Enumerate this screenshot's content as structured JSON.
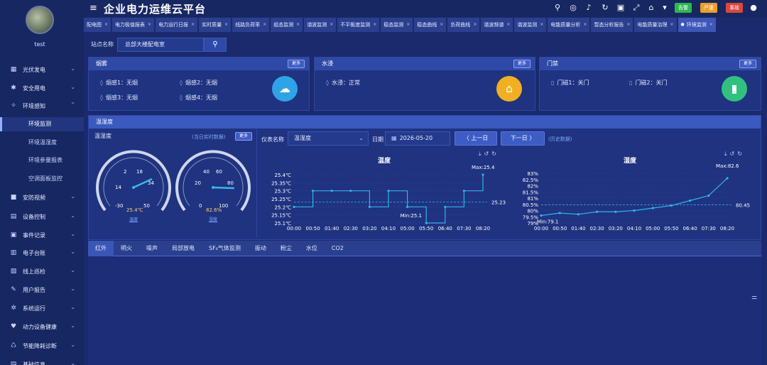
{
  "app": {
    "title": "企业电力运维云平台"
  },
  "user": {
    "name": "test"
  },
  "sidebar": {
    "items": [
      {
        "label": "光伏发电",
        "icon": "solar-icon",
        "glyph": "▦"
      },
      {
        "label": "安全用电",
        "icon": "shield-icon",
        "glyph": "✱"
      },
      {
        "label": "环境感知",
        "icon": "sensor-icon",
        "glyph": "✧"
      },
      {
        "label": "安防视频",
        "icon": "video-icon",
        "glyph": "■"
      },
      {
        "label": "设备控制",
        "icon": "device-icon",
        "glyph": "▤"
      },
      {
        "label": "事件记录",
        "icon": "record-icon",
        "glyph": "▣"
      },
      {
        "label": "电子台账",
        "icon": "ledger-icon",
        "glyph": "▥"
      },
      {
        "label": "线上巡检",
        "icon": "patrol-icon",
        "glyph": "▧"
      },
      {
        "label": "用户报告",
        "icon": "report-icon",
        "glyph": "✎"
      },
      {
        "label": "系统运行",
        "icon": "system-icon",
        "glyph": "✲"
      },
      {
        "label": "动力设备健康",
        "icon": "health-icon",
        "glyph": "♥"
      },
      {
        "label": "节能降耗诊断",
        "icon": "energy-icon",
        "glyph": "♺"
      },
      {
        "label": "基础信息",
        "icon": "info-icon",
        "glyph": "▤"
      }
    ],
    "subitems": [
      "环境监测",
      "环境温湿度",
      "环境参量报表",
      "空调面板监控"
    ]
  },
  "header": {
    "badges": [
      {
        "label": "告警",
        "color": "#2db84d"
      },
      {
        "label": "严重",
        "color": "#f0a020"
      },
      {
        "label": "事故",
        "color": "#e0453c"
      }
    ]
  },
  "tabs": [
    "配电图",
    "电力极值报表",
    "电力运行日报",
    "实时质量",
    "线路负荷率",
    "组态监测",
    "谐波监测",
    "不平衡度监测",
    "稳态监测",
    "稳态曲线",
    "负荷曲线",
    "谐波频谱",
    "谐波监测",
    "电能质量分析",
    "暂态分析报告",
    "电能质量治理",
    "环境监测"
  ],
  "station": {
    "label": "站点名称",
    "value": "总部大楼配电室"
  },
  "cards": {
    "smoke": {
      "title": "烟雾",
      "more": "更多",
      "items": [
        "烟感1：无烟",
        "烟感2：无烟",
        "烟感3：无烟",
        "烟感4：无烟"
      ]
    },
    "water": {
      "title": "水浸",
      "more": "更多",
      "items": [
        "水浸：正常"
      ]
    },
    "door": {
      "title": "门禁",
      "more": "更多",
      "items": [
        "门磁1：关门",
        "门磁2：关门"
      ]
    }
  },
  "thp": {
    "title": "温湿度",
    "left_label": "温湿度",
    "realtime": "(当日实时数据)",
    "more": "更多",
    "gauge1": {
      "value": "25.4℃",
      "link": "温度",
      "ticks": [
        "-30",
        "2",
        "18",
        "34",
        "14",
        "50"
      ]
    },
    "gauge2": {
      "value": "82.6%",
      "link": "湿度",
      "ticks": [
        "0",
        "20",
        "40",
        "60",
        "80",
        "100"
      ]
    },
    "instr_label": "仪表名称",
    "instr_value": "温湿度",
    "date_label": "日期",
    "date_value": "2026-05-20",
    "prev": "〈 上一日",
    "next": "下一日 〉",
    "history": "(历史数据)"
  },
  "chart_data": [
    {
      "type": "line",
      "title": "温度",
      "x": [
        "00:00",
        "00:50",
        "01:40",
        "02:30",
        "03:20",
        "04:10",
        "05:00",
        "05:50",
        "06:40",
        "07:30",
        "08:20"
      ],
      "ylim": [
        25.1,
        25.4
      ],
      "yticks": [
        "25.4℃",
        "25.35℃",
        "25.3℃",
        "25.25℃",
        "25.2℃",
        "25.15℃",
        "25.1℃"
      ],
      "series": [
        {
          "values": [
            25.2,
            25.3,
            25.3,
            25.3,
            25.2,
            25.3,
            25.2,
            25.1,
            25.2,
            25.3,
            25.4
          ]
        }
      ],
      "annotations": {
        "max": "Max:25.4",
        "min": "Min:25.1",
        "avg": "25.23"
      }
    },
    {
      "type": "line",
      "title": "湿度",
      "x": [
        "00:00",
        "00:50",
        "01:40",
        "02:30",
        "03:20",
        "04:10",
        "05:00",
        "05:50",
        "06:40",
        "07:30",
        "08:20"
      ],
      "ylim": [
        79,
        83
      ],
      "yticks": [
        "83%",
        "82.5%",
        "82%",
        "81.5%",
        "81%",
        "80.5%",
        "80%",
        "79.5%",
        "79%"
      ],
      "series": [
        {
          "values": [
            79.6,
            79.8,
            79.7,
            79.9,
            79.9,
            80.0,
            80.2,
            80.4,
            80.8,
            81.2,
            82.6
          ]
        }
      ],
      "annotations": {
        "max": "Max:82.6",
        "min": "Min:79.1",
        "avg": "80.45"
      }
    }
  ],
  "bottom_tabs": [
    "红外",
    "明火",
    "噪声",
    "局部放电",
    "SF₆气体监测",
    "振动",
    "粉尘",
    "水位",
    "CO2"
  ]
}
